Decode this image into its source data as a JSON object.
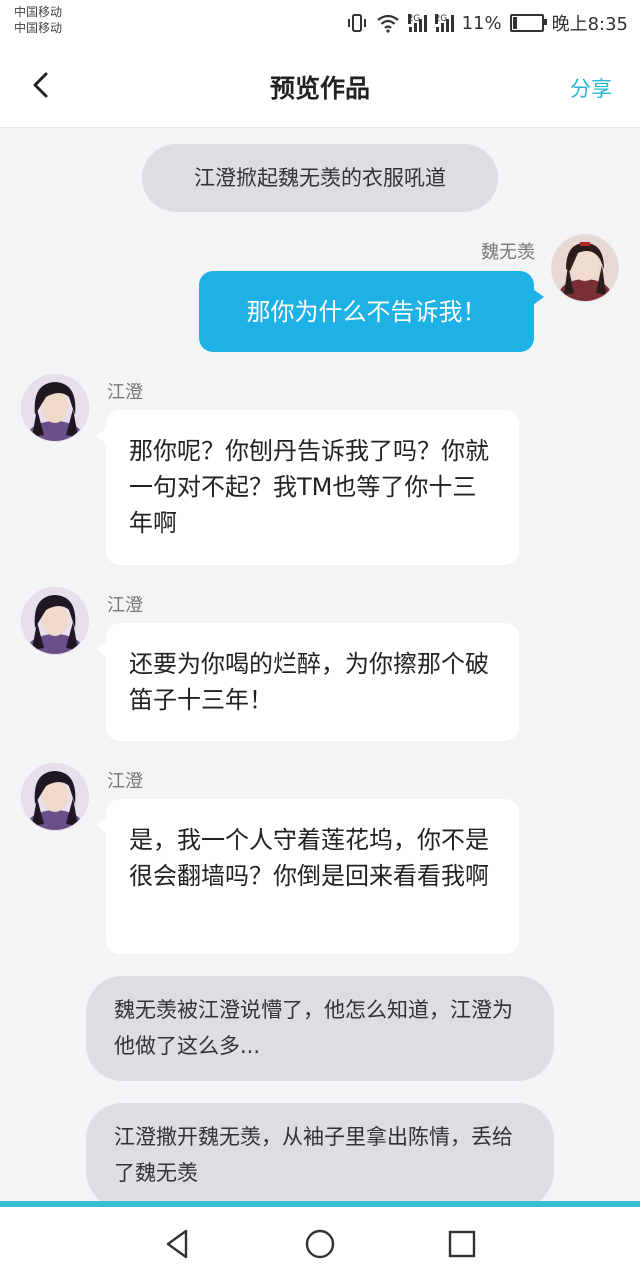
{
  "status_bar": {
    "carrier_1": "中国移动",
    "carrier_2": "中国移动",
    "network_1": "2G",
    "network_2": "2G",
    "battery": "11%",
    "time": "晚上8:35"
  },
  "header": {
    "title": "预览作品",
    "share_label": "分享"
  },
  "messages": [
    {
      "type": "narration",
      "text": "江澄掀起魏无羡的衣服吼道"
    },
    {
      "type": "outgoing",
      "sender": "魏无羡",
      "text": "那你为什么不告诉我！",
      "avatar": "wei-wuxian-avatar"
    },
    {
      "type": "incoming",
      "sender": "江澄",
      "text": "那你呢？你刨丹告诉我了吗？你就一句对不起？我TM也等了你十三年啊",
      "avatar": "jiang-cheng-avatar"
    },
    {
      "type": "incoming",
      "sender": "江澄",
      "text": "还要为你喝的烂醉，为你擦那个破笛子十三年！",
      "avatar": "jiang-cheng-avatar"
    },
    {
      "type": "incoming",
      "sender": "江澄",
      "text": "是，我一个人守着莲花坞，你不是很会翻墙吗？你倒是回来看看我啊",
      "avatar": "jiang-cheng-avatar"
    },
    {
      "type": "narration",
      "text": "魏无羡被江澄说懵了，他怎么知道，江澄为他做了这么多..."
    },
    {
      "type": "narration",
      "text": "江澄撒开魏无羡，从袖子里拿出陈情，丢给了魏无羡"
    }
  ],
  "colors": {
    "accent": "#2bb7cf",
    "outgoing_bubble": "#1eb1e6",
    "background": "#f3f4f6",
    "narration_bubble": "#dcdee4"
  }
}
